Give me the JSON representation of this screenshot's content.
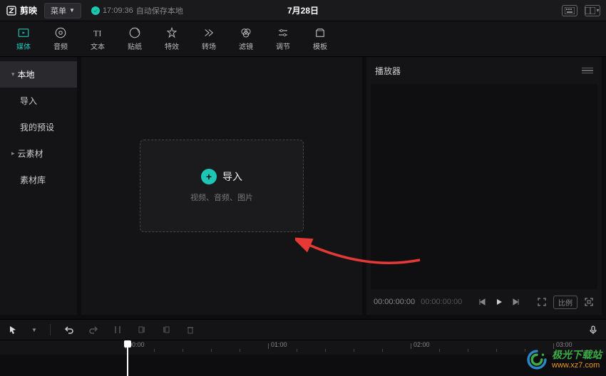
{
  "titlebar": {
    "app_name": "剪映",
    "menu_label": "菜单",
    "autosave_time": "17:09:36",
    "autosave_text": "自动保存本地",
    "project_title": "7月28日"
  },
  "tooltabs": [
    {
      "key": "media",
      "label": "媒体"
    },
    {
      "key": "audio",
      "label": "音频"
    },
    {
      "key": "text",
      "label": "文本"
    },
    {
      "key": "sticker",
      "label": "贴纸"
    },
    {
      "key": "effect",
      "label": "特效"
    },
    {
      "key": "transition",
      "label": "转场"
    },
    {
      "key": "filter",
      "label": "滤镜"
    },
    {
      "key": "adjust",
      "label": "调节"
    },
    {
      "key": "template",
      "label": "模板"
    }
  ],
  "sidebar": {
    "items": [
      {
        "label": "本地",
        "expandable": true,
        "active": true
      },
      {
        "label": "导入",
        "expandable": false,
        "active": false
      },
      {
        "label": "我的预设",
        "expandable": false,
        "active": false
      },
      {
        "label": "云素材",
        "expandable": true,
        "active": false
      },
      {
        "label": "素材库",
        "expandable": false,
        "active": false
      }
    ]
  },
  "import": {
    "main_label": "导入",
    "sub_label": "视频、音频、图片"
  },
  "player": {
    "title": "播放器",
    "time_current": "00:00:00:00",
    "time_total": "00:00:00:00",
    "ratio_label": "比例"
  },
  "ruler": {
    "marks": [
      "00:00",
      "01:00",
      "02:00",
      "03:00"
    ]
  },
  "watermark": {
    "line1": "极光下载站",
    "line2": "www.xz7.com"
  }
}
